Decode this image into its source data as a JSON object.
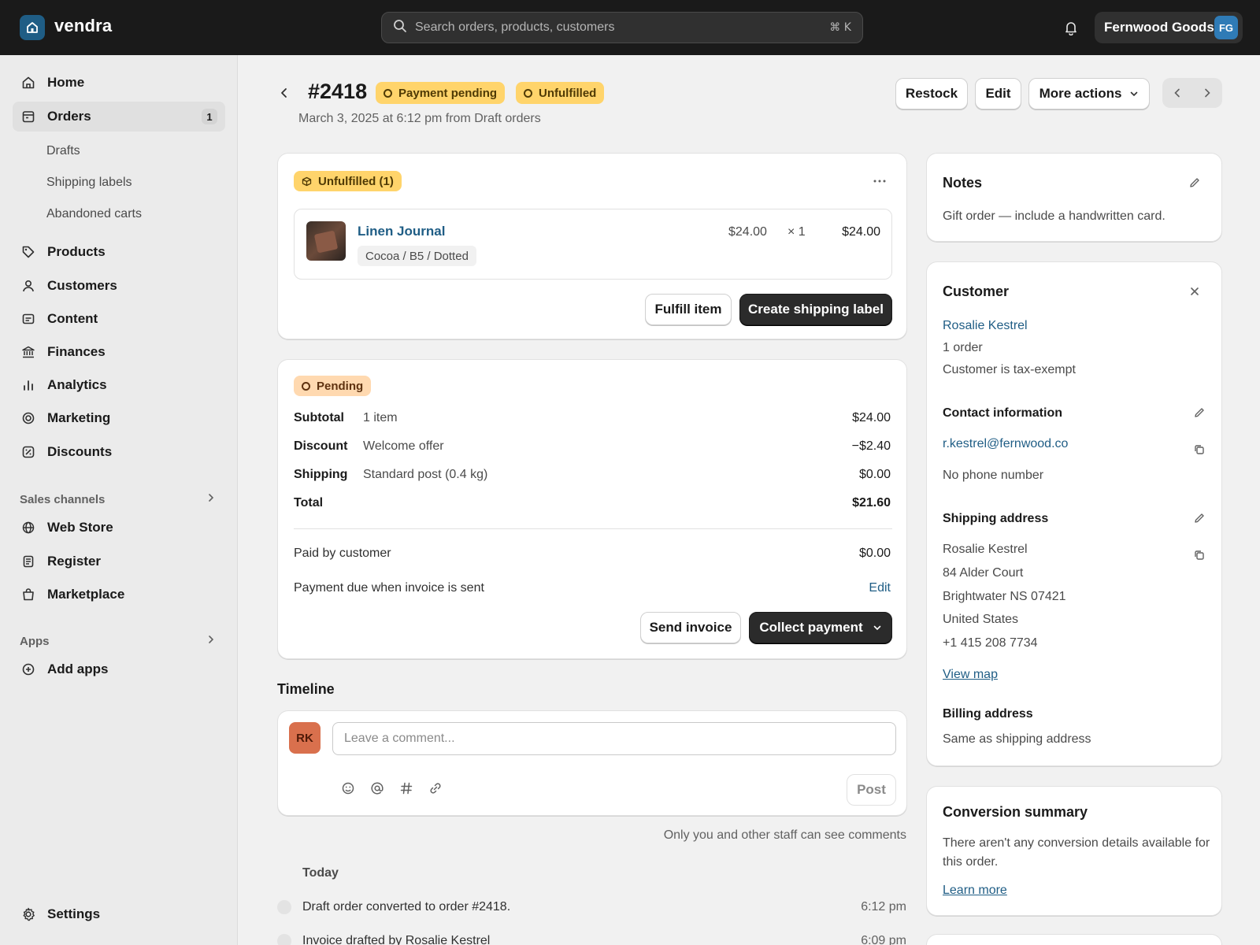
{
  "app": {
    "name": "vendra"
  },
  "search": {
    "placeholder": "Search orders, products, customers",
    "shortcut": "⌘ K"
  },
  "store": {
    "name": "Fernwood Goods",
    "initials": "FG"
  },
  "sidebar": {
    "items": [
      {
        "label": "Home",
        "icon": "home-icon"
      },
      {
        "label": "Orders",
        "icon": "orders-icon",
        "count": "1",
        "active": true
      },
      {
        "label": "Products",
        "icon": "tag-icon"
      },
      {
        "label": "Customers",
        "icon": "person-icon"
      },
      {
        "label": "Content",
        "icon": "content-icon"
      },
      {
        "label": "Finances",
        "icon": "bank-icon"
      },
      {
        "label": "Analytics",
        "icon": "bar-chart-icon"
      },
      {
        "label": "Marketing",
        "icon": "target-icon"
      },
      {
        "label": "Discounts",
        "icon": "discount-icon"
      }
    ],
    "order_subitems": [
      "Drafts",
      "Shipping labels",
      "Abandoned carts"
    ],
    "sales_channels_label": "Sales channels",
    "channels": [
      {
        "label": "Web Store",
        "icon": "globe-icon"
      },
      {
        "label": "Register",
        "icon": "register-icon"
      },
      {
        "label": "Marketplace",
        "icon": "bag-icon"
      }
    ],
    "apps_label": "Apps",
    "add_apps": "Add apps",
    "settings": "Settings"
  },
  "header": {
    "order_number": "#2418",
    "payment_badge": "Payment pending",
    "fulfillment_badge": "Unfulfilled",
    "subtitle": "March 3, 2025 at 6:12 pm from Draft orders",
    "restock": "Restock",
    "edit": "Edit",
    "more_actions": "More actions"
  },
  "fulfillment": {
    "badge": "Unfulfilled (1)",
    "item": {
      "name": "Linen Journal",
      "variant": "Cocoa / B5 / Dotted",
      "unit_price": "$24.00",
      "qty": "× 1",
      "total": "$24.00"
    },
    "fulfill_btn": "Fulfill item",
    "label_btn": "Create shipping label"
  },
  "payment": {
    "badge": "Pending",
    "rows": [
      {
        "label": "Subtotal",
        "detail": "1 item",
        "value": "$24.00"
      },
      {
        "label": "Discount",
        "detail": "Welcome offer",
        "value": "−$2.40"
      },
      {
        "label": "Shipping",
        "detail": "Standard post (0.4 kg)",
        "value": "$0.00"
      },
      {
        "label": "Total",
        "detail": "",
        "value": "$21.60"
      }
    ],
    "paid_label": "Paid by customer",
    "paid_value": "$0.00",
    "due_label": "Payment due when invoice is sent",
    "due_edit": "Edit",
    "send_invoice": "Send invoice",
    "collect_payment": "Collect payment"
  },
  "timeline": {
    "title": "Timeline",
    "avatar": "RK",
    "placeholder": "Leave a comment...",
    "post": "Post",
    "note": "Only you and other staff can see comments",
    "day": "Today",
    "events": [
      {
        "text": "Draft order converted to order #2418.",
        "time": "6:12 pm"
      },
      {
        "text": "Invoice drafted by Rosalie Kestrel",
        "time": "6:09 pm"
      }
    ]
  },
  "notes": {
    "title": "Notes",
    "text": "Gift order — include a handwritten card."
  },
  "customer": {
    "title": "Customer",
    "name": "Rosalie Kestrel",
    "orders": "1 order",
    "tax": "Customer is tax-exempt",
    "contact_title": "Contact information",
    "email": "r.kestrel@fernwood.co",
    "phone": "No phone number",
    "shipping_title": "Shipping address",
    "address": [
      "Rosalie Kestrel",
      "84 Alder Court",
      "Brightwater NS 07421",
      "United States",
      "+1 415 208 7734"
    ],
    "view_map": "View map",
    "billing_title": "Billing address",
    "billing_text": "Same as shipping address"
  },
  "conversion": {
    "title": "Conversion summary",
    "text": "There aren't any conversion details available for this order.",
    "learn_more": "Learn more"
  }
}
